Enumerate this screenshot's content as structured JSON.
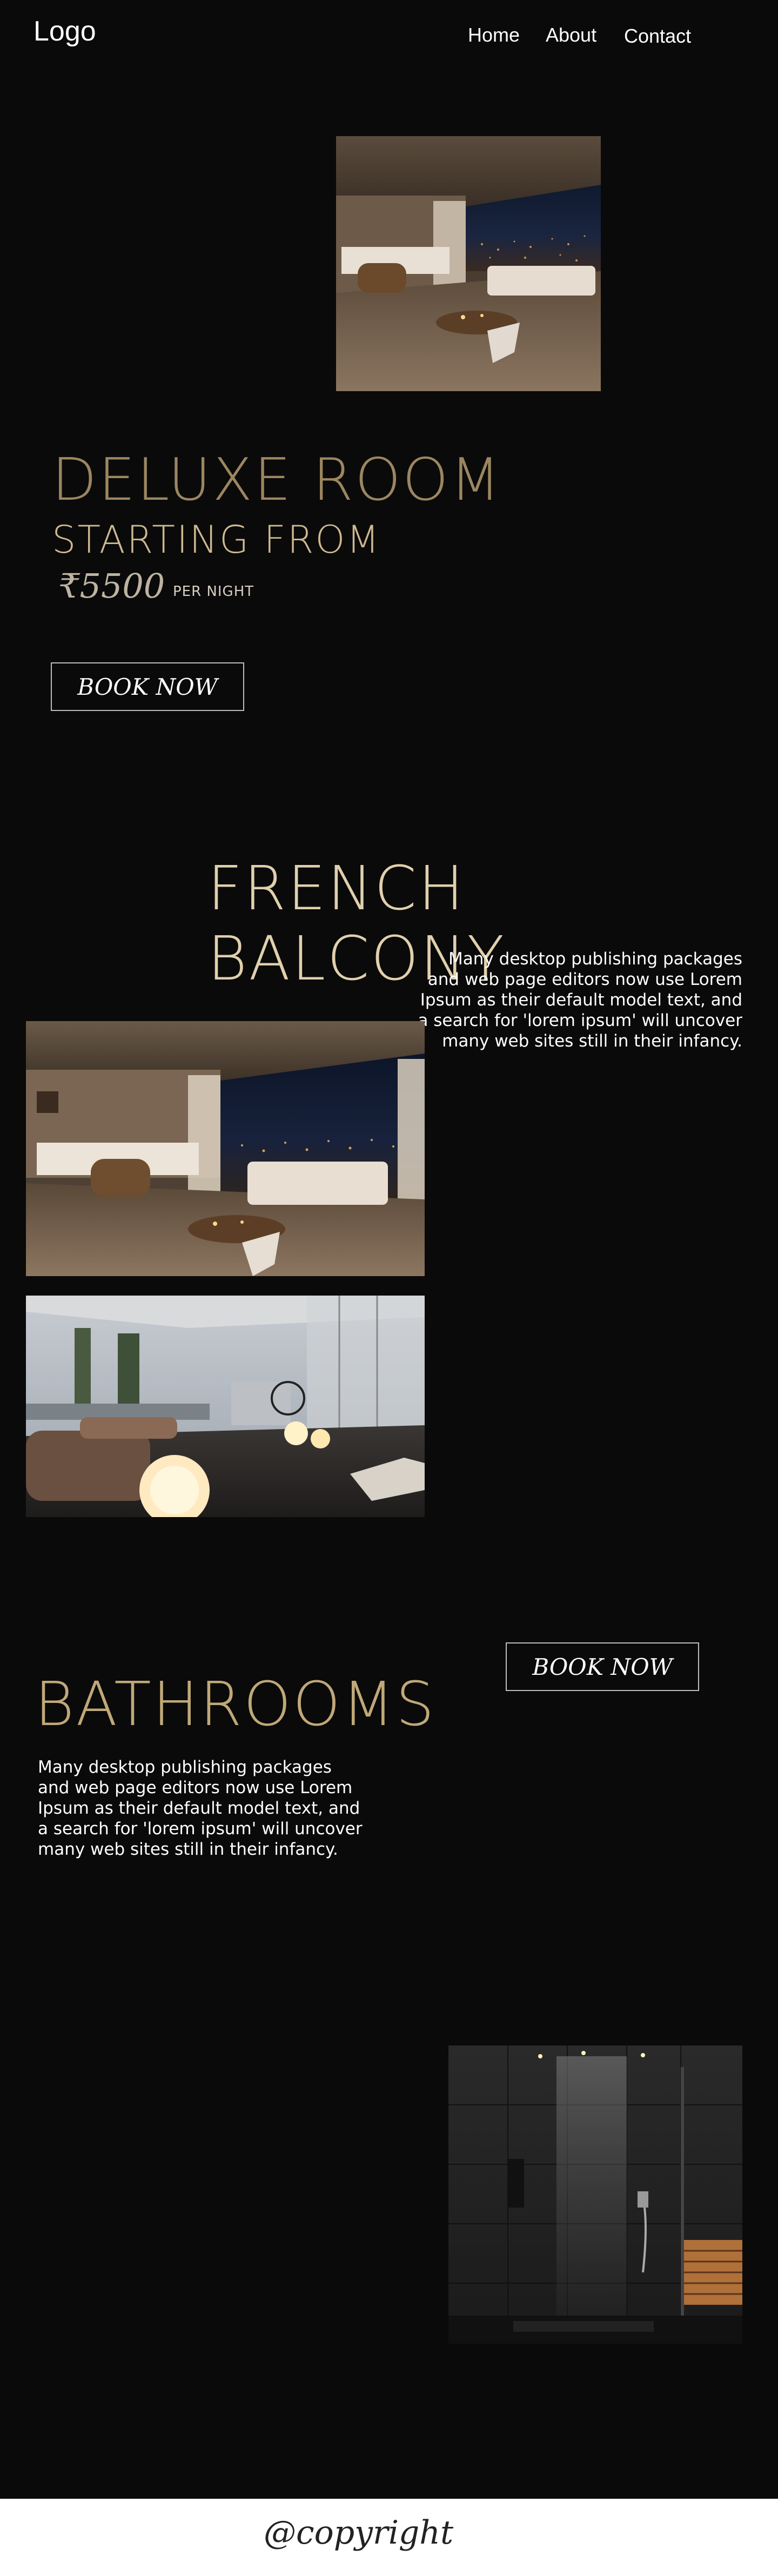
{
  "header": {
    "logo": "Logo",
    "nav": [
      {
        "label": "Home"
      },
      {
        "label": "About"
      },
      {
        "label": "Contact"
      }
    ]
  },
  "deluxe": {
    "title": "DELUXE ROOM",
    "subtitle": "STARTING FROM",
    "price": "₹5500",
    "price_unit": "PER NIGHT",
    "book_label": "BOOK NOW"
  },
  "balcony": {
    "title": "FRENCH BALCONY",
    "description_lines": [
      "Many desktop publishing packages",
      "and web page editors now use Lorem",
      "Ipsum as their default model text, and",
      "a search for 'lorem ipsum' will uncover",
      "many web sites still in their infancy."
    ]
  },
  "bathrooms": {
    "title": "BATHROOMS",
    "book_label": "BOOK NOW",
    "description_lines": [
      "Many desktop publishing packages",
      "and web page editors now use Lorem",
      "Ipsum as their default model text, and",
      "a search for 'lorem ipsum' will uncover",
      "many web sites still in their infancy."
    ]
  },
  "footer": {
    "copyright": "@copyright"
  },
  "colors": {
    "background": "#0a0a0a",
    "accent_gold": "#9c8660",
    "accent_light_gold": "#d8c6a0",
    "footer_bg": "#ffffff"
  }
}
